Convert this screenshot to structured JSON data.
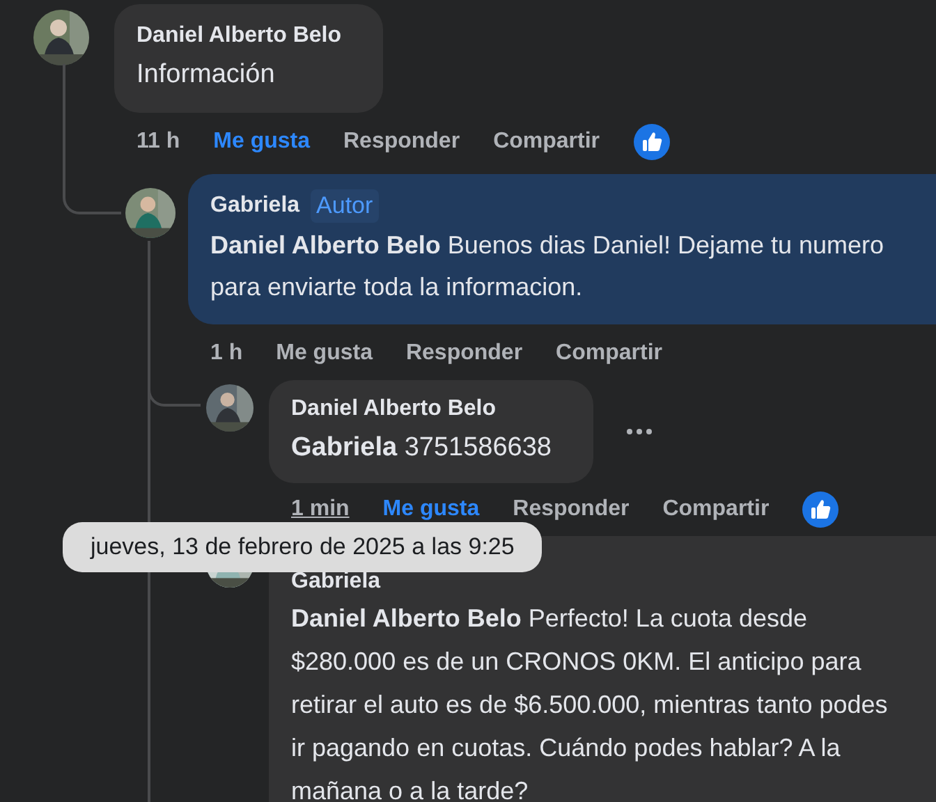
{
  "comments": [
    {
      "author": "Daniel Alberto Belo",
      "text": "Información",
      "highlighted": false,
      "time": "11 h",
      "like_label": "Me gusta",
      "liked": true,
      "reply_label": "Responder",
      "share_label": "Compartir",
      "reacted": true,
      "children": [
        {
          "author": "Gabriela",
          "badge": "Autor",
          "text": "**Daniel Alberto Belo** Buenos dias Daniel! Dejame tu numero para enviarte toda la informacion.",
          "highlighted": true,
          "time": "1 h",
          "like_label": "Me gusta",
          "liked": false,
          "reply_label": "Responder",
          "share_label": "Compartir",
          "children": [
            {
              "author": "Daniel Alberto Belo",
              "text": "**Gabriela** 3751586638",
              "highlighted": false,
              "time": "1 min",
              "time_hovered": true,
              "like_label": "Me gusta",
              "liked": true,
              "reply_label": "Responder",
              "share_label": "Compartir",
              "reacted": true,
              "more_menu": true
            },
            {
              "author": "Gabriela",
              "text": "**Daniel Alberto Belo** Perfecto! La cuota desde $280.000 es de un CRONOS 0KM. El anticipo para retirar el auto es de $6.500.000, mientras tanto podes ir pagando en cuotas. Cuándo podes hablar? A la mañana o a la tarde?",
              "highlighted": false
            }
          ]
        }
      ]
    }
  ],
  "tooltip": {
    "text": "jueves, 13 de febrero de 2025 a las 9:25"
  }
}
